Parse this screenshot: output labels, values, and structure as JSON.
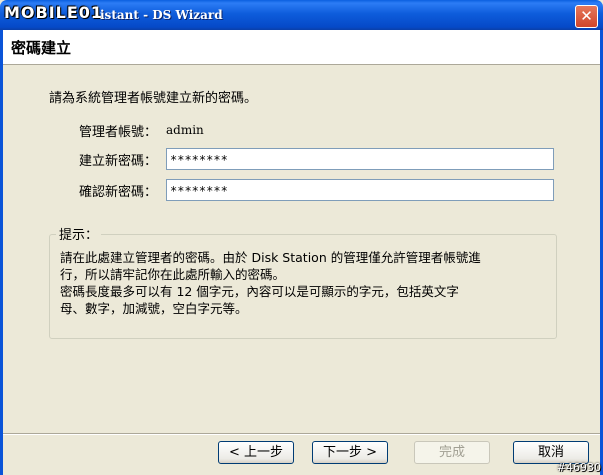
{
  "window": {
    "logo": "MOBILE01",
    "title": "Disk Station Assistant - DS Wizard",
    "title_visible": "istant  - DS Wizard",
    "close_glyph": "✕"
  },
  "header": {
    "title": "密碼建立"
  },
  "form": {
    "intro": "請為系統管理者帳號建立新的密碼。",
    "admin_label": "管理者帳號：",
    "admin_value": "admin",
    "new_password_label": "建立新密碼：",
    "new_password_value": "********",
    "confirm_password_label": "確認新密碼：",
    "confirm_password_value": "********"
  },
  "hint": {
    "title": "提示：",
    "line1": "請在此處建立管理者的密碼。由於 Disk Station 的管理僅允許管理者帳號進",
    "line2": "行，所以請牢記你在此處所輸入的密碼。",
    "line3": "密碼長度最多可以有 12 個字元，內容可以是可顯示的字元，包括英文字",
    "line4": "母、數字，加減號，空白字元等。"
  },
  "buttons": {
    "back": "< 上一步",
    "next": "下一步 >",
    "finish": "完成",
    "cancel": "取消"
  },
  "watermark": "#46930"
}
